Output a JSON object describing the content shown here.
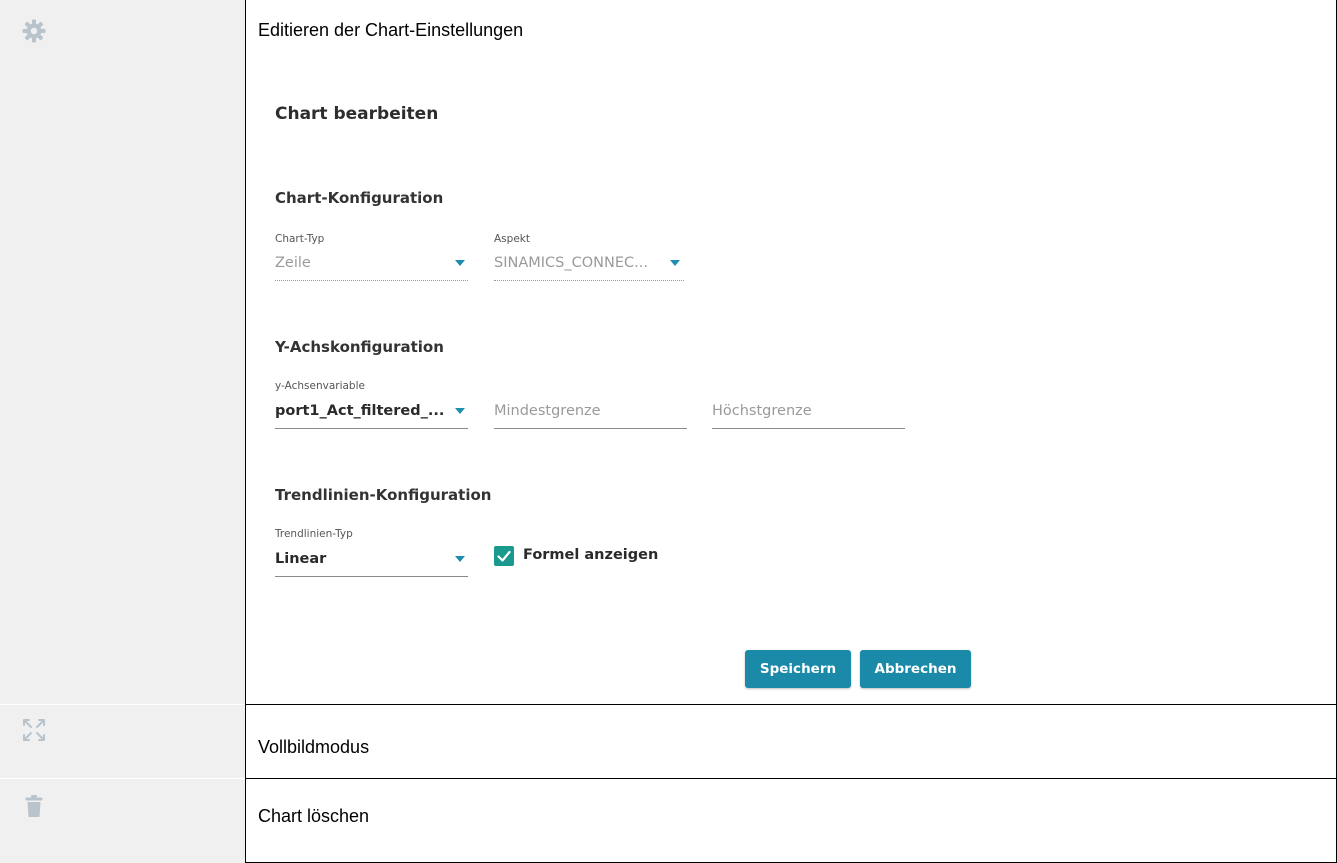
{
  "rows": [
    {
      "icon": "gear-icon",
      "description": "Editieren der Chart-Einstellungen"
    },
    {
      "icon": "fullscreen-icon",
      "description": "Vollbildmodus"
    },
    {
      "icon": "trash-icon",
      "description": "Chart löschen"
    }
  ],
  "dialog": {
    "title": "Chart bearbeiten",
    "chart_config": {
      "section_title": "Chart-Konfiguration",
      "chart_type": {
        "label": "Chart-Typ",
        "value": "Zeile"
      },
      "aspect": {
        "label": "Aspekt",
        "value": "SINAMICS_CONNEC..."
      }
    },
    "y_axis_config": {
      "section_title": "Y-Achskonfiguration",
      "variable": {
        "label": "y-Achsenvariable",
        "value": "port1_Act_filtered_..."
      },
      "min_placeholder": "Mindestgrenze",
      "max_placeholder": "Höchstgrenze"
    },
    "trendline_config": {
      "section_title": "Trendlinien-Konfiguration",
      "type": {
        "label": "Trendlinien-Typ",
        "value": "Linear"
      },
      "show_formula": {
        "label": "Formel anzeigen",
        "checked": true
      }
    },
    "buttons": {
      "save": "Speichern",
      "cancel": "Abbrechen"
    }
  },
  "colors": {
    "accent": "#1e8db0",
    "button": "#1b8aa9",
    "checkbox": "#1a9a8e",
    "icon": "#b9c3cc"
  }
}
